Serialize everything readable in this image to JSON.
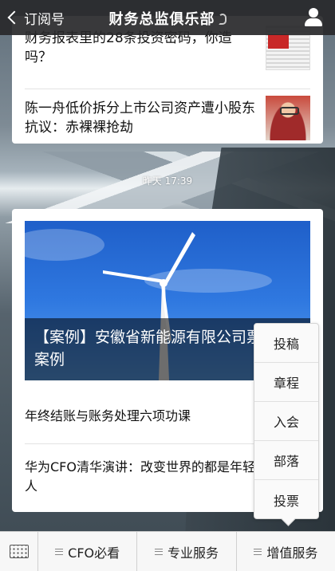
{
  "header": {
    "back_label": "订阅号",
    "title": "财务总监俱乐部"
  },
  "feed": {
    "card1": {
      "items": [
        {
          "text": "财务报表里的28条投资密码，你造吗？"
        },
        {
          "text": "陈一舟低价拆分上市公司资产遭小股东抗议：赤裸裸抢劫"
        }
      ]
    },
    "timestamp": "昨天 17:39",
    "card2": {
      "hero_title": "【案例】安徽省新能源有限公司票融资案例",
      "items": [
        {
          "text": "年终结账与账务处理六项功课"
        },
        {
          "text": "华为CFO清华演讲：改变世界的都是年轻人"
        }
      ]
    }
  },
  "popup_menu": {
    "items": [
      "投稿",
      "章程",
      "入会",
      "部落",
      "投票"
    ]
  },
  "bottom_menu": {
    "tabs": [
      "CFO必看",
      "专业服务",
      "增值服务"
    ]
  },
  "icons": {
    "back": "chevron-left-icon",
    "ear": "ear-icon",
    "user": "user-icon",
    "keyboard": "keyboard-icon",
    "menu": "hamburger-icon"
  }
}
